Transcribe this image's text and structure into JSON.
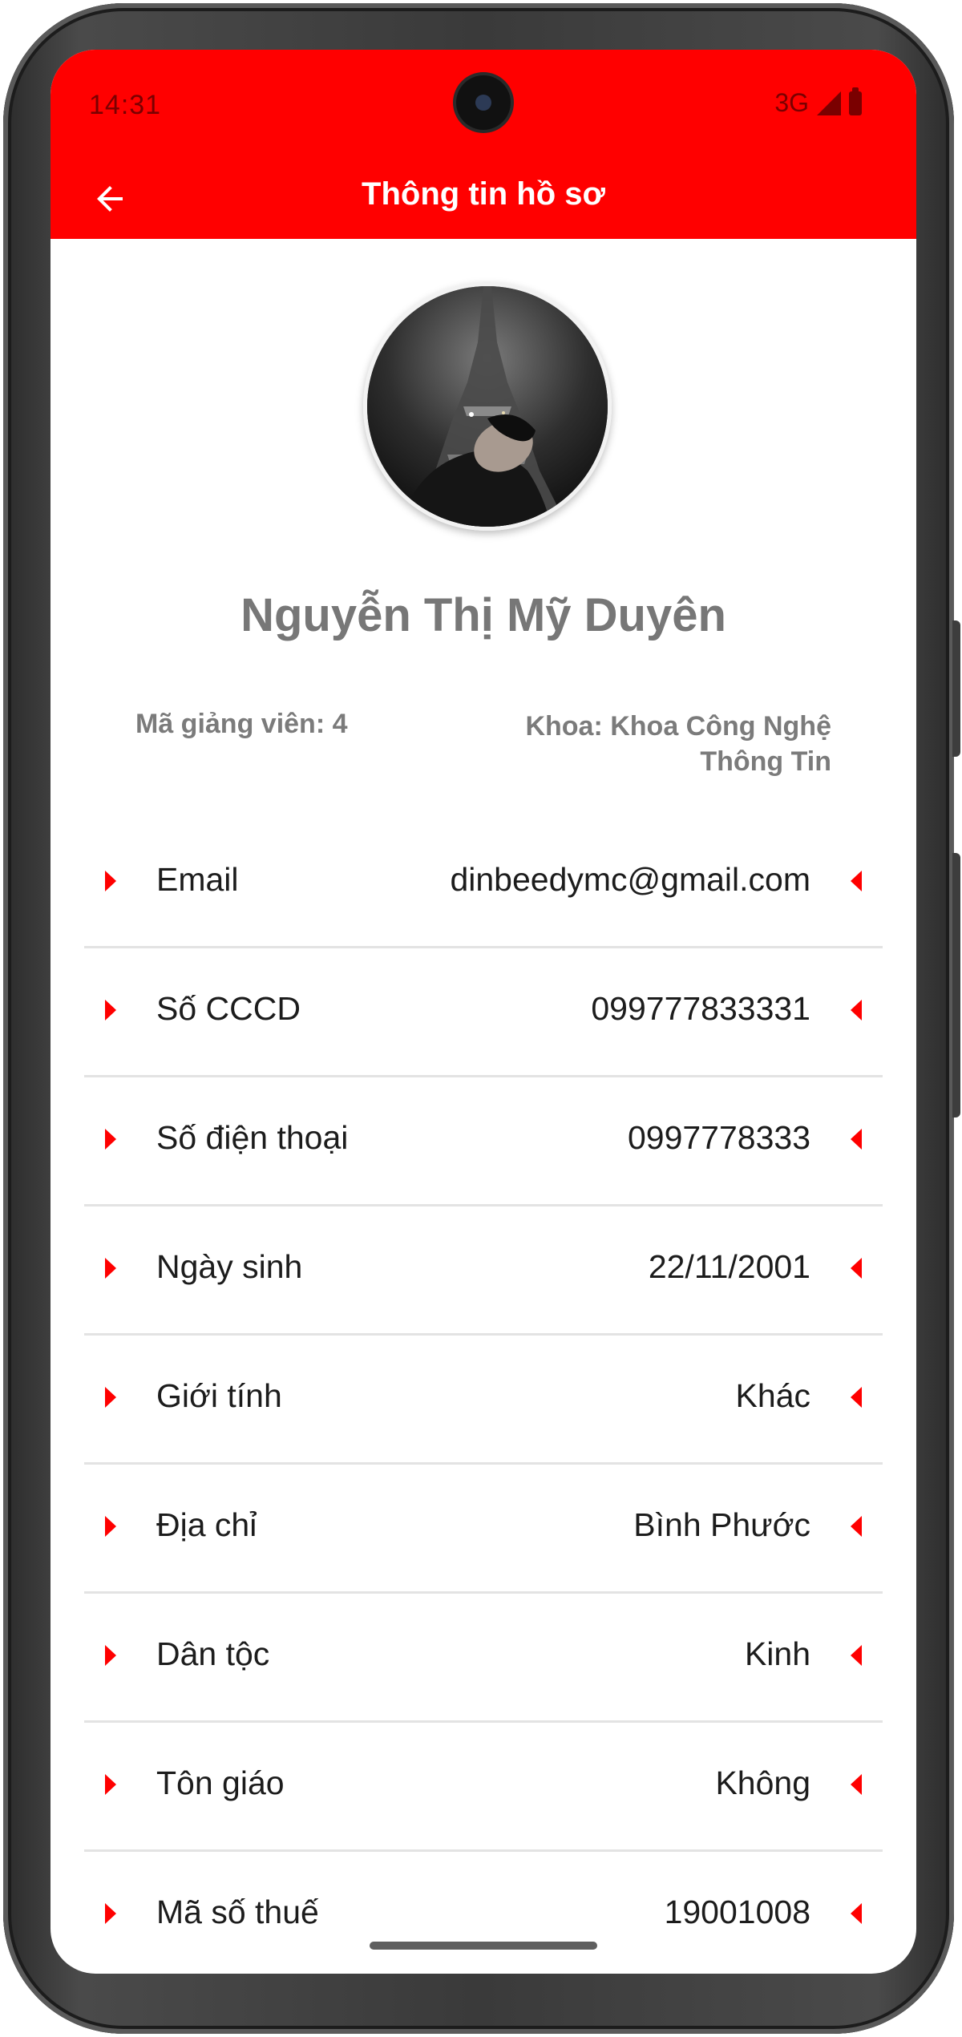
{
  "status_bar": {
    "time": "14:31",
    "network": "3G",
    "icons": [
      "signal-icon",
      "battery-icon"
    ]
  },
  "app_bar": {
    "title": "Thông tin hồ sơ",
    "back_icon": "arrow-back-icon",
    "background_color": "#ff0000"
  },
  "profile": {
    "name": "Nguyễn Thị Mỹ Duyên",
    "lecturer_id": "Mã giảng viên: 4",
    "faculty": "Khoa: Khoa Công Nghệ Thông Tin"
  },
  "info_rows": [
    {
      "label": "Email",
      "value": "dinbeedymc@gmail.com"
    },
    {
      "label": "Số CCCD",
      "value": "099777833331"
    },
    {
      "label": "Số điện thoại",
      "value": "0997778333"
    },
    {
      "label": "Ngày sinh",
      "value": "22/11/2001"
    },
    {
      "label": "Giới tính",
      "value": "Khác"
    },
    {
      "label": "Địa chỉ",
      "value": "Bình Phước"
    },
    {
      "label": "Dân tộc",
      "value": "Kinh"
    },
    {
      "label": "Tôn giáo",
      "value": "Không"
    },
    {
      "label": "Mã số thuế",
      "value": "19001008"
    }
  ],
  "colors": {
    "accent": "#ff0000",
    "name_text": "#777777",
    "meta_text": "#7b7b7b",
    "divider": "#e3e3e3"
  }
}
